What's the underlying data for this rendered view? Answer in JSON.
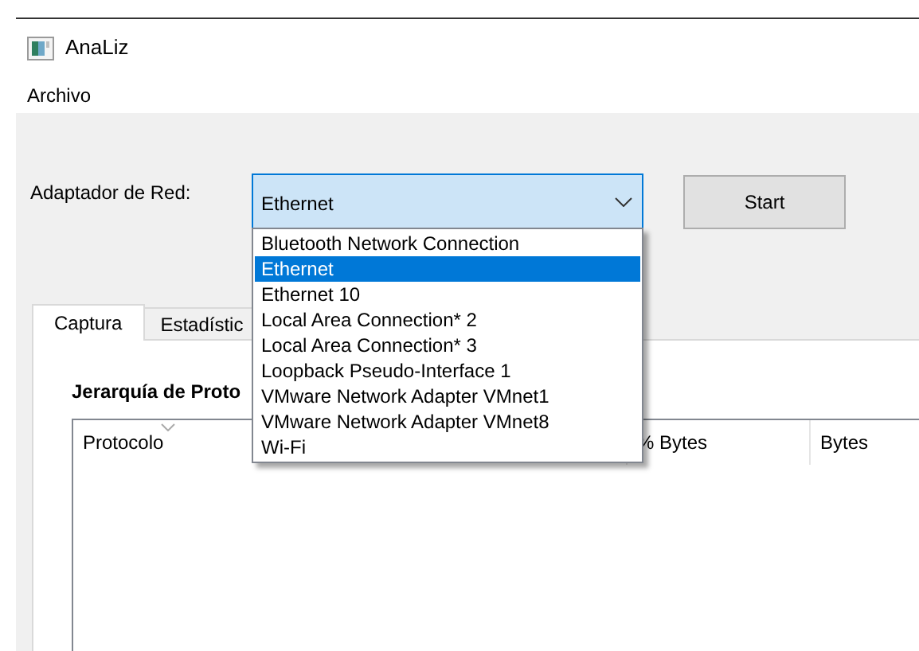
{
  "window": {
    "title": "AnaLiz"
  },
  "menu": [
    "Archivo"
  ],
  "adapter": {
    "label": "Adaptador de Red:",
    "value": "Ethernet",
    "expanded": true,
    "options": [
      {
        "label": "Bluetooth Network Connection",
        "selected": false
      },
      {
        "label": "Ethernet",
        "selected": true
      },
      {
        "label": "Ethernet 10",
        "selected": false
      },
      {
        "label": "Local Area Connection* 2",
        "selected": false
      },
      {
        "label": "Local Area Connection* 3",
        "selected": false
      },
      {
        "label": "Loopback Pseudo-Interface 1",
        "selected": false
      },
      {
        "label": "VMware Network Adapter VMnet1",
        "selected": false
      },
      {
        "label": "VMware Network Adapter VMnet8",
        "selected": false
      },
      {
        "label": "Wi-Fi",
        "selected": false
      }
    ]
  },
  "start_button": "Start",
  "tabs": [
    {
      "label": "Captura",
      "selected": true
    },
    {
      "label": "Estadístic",
      "selected": false
    }
  ],
  "hierarchy": {
    "title": "Jerarquía de Proto",
    "columns": [
      "Protocolo",
      "% Bytes",
      "Bytes"
    ]
  }
}
